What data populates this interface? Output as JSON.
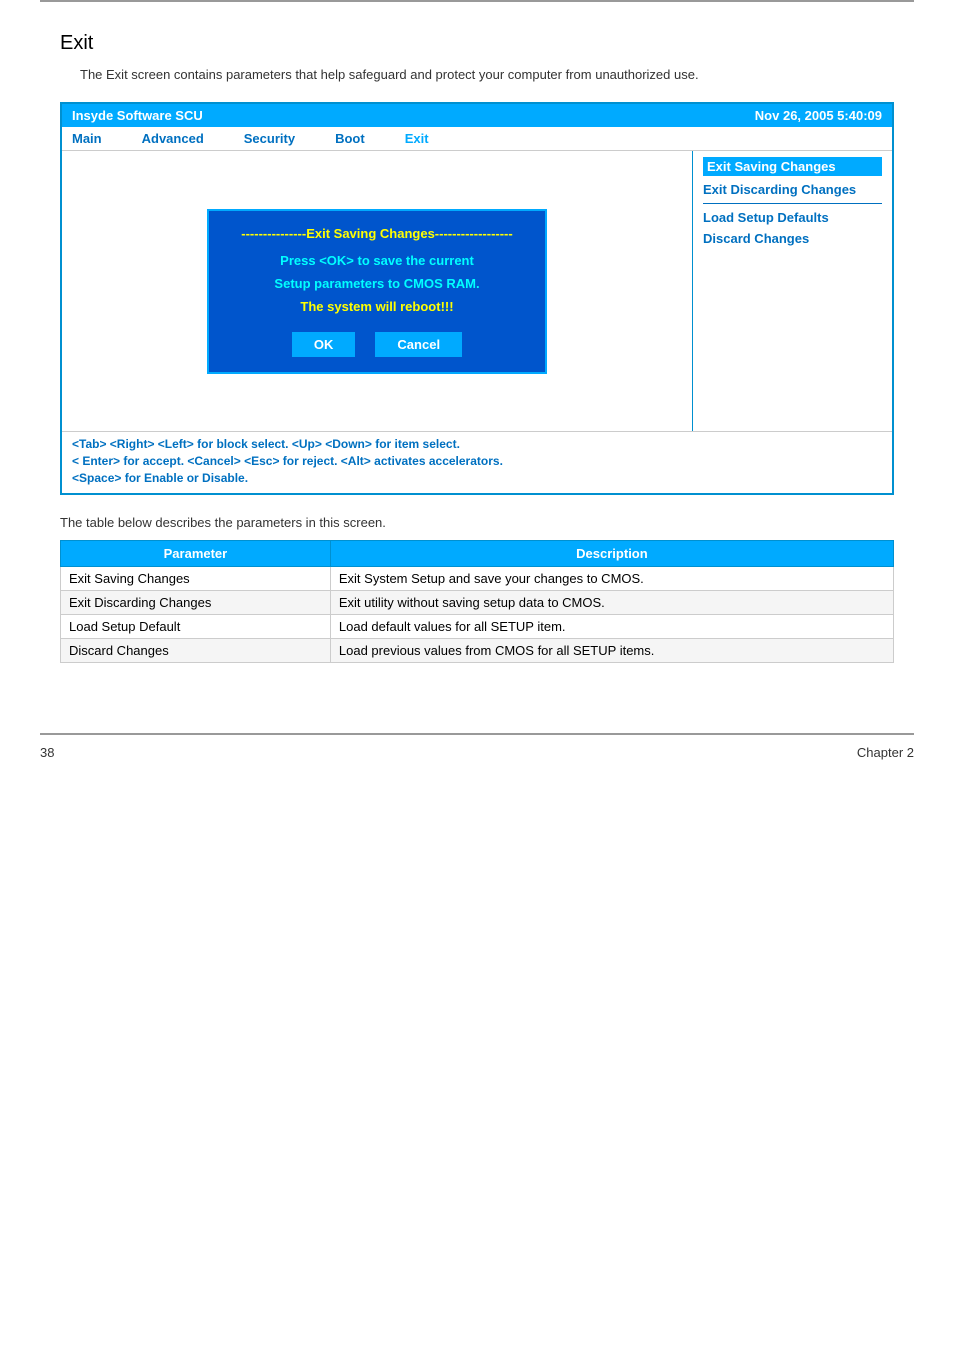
{
  "page": {
    "title": "Exit",
    "intro": "The Exit screen contains parameters that help safeguard and protect your computer from unauthorized use."
  },
  "bios": {
    "header": {
      "left": "Insyde Software SCU",
      "right": "Nov 26, 2005 5:40:09"
    },
    "nav": [
      {
        "label": "Main",
        "active": false
      },
      {
        "label": "Advanced",
        "active": false
      },
      {
        "label": "Security",
        "active": false
      },
      {
        "label": "Boot",
        "active": false
      },
      {
        "label": "Exit",
        "active": true
      }
    ],
    "right_panel": [
      {
        "label": "Exit Saving Changes",
        "highlight": true
      },
      {
        "label": "Exit Discarding Changes",
        "highlight": false
      },
      {
        "label": "Load Setup Defaults",
        "highlight": false
      },
      {
        "label": "Discard Changes",
        "highlight": false
      }
    ],
    "dialog": {
      "title": "---------------Exit Saving Changes------------------",
      "line1": "Press  <OK>  to  save  the current",
      "line2": "Setup parameters to CMOS RAM.",
      "line3": "The system will reboot!!!",
      "ok_btn": "OK",
      "cancel_btn": "Cancel"
    },
    "footer": [
      "<Tab> <Right> <Left> for block select.   <Up> <Down> for item select.",
      "< Enter> for accept. <Cancel> <Esc> for reject. <Alt> activates accelerators.",
      "<Space> for Enable or Disable."
    ]
  },
  "table": {
    "intro": "The table below describes the parameters in this screen.",
    "headers": [
      "Parameter",
      "Description"
    ],
    "rows": [
      {
        "param": "Exit Saving Changes",
        "desc": "Exit System Setup and save your changes to CMOS."
      },
      {
        "param": "Exit Discarding Changes",
        "desc": "Exit utility without saving setup data to CMOS."
      },
      {
        "param": "Load Setup Default",
        "desc": "Load default values for all SETUP item."
      },
      {
        "param": "Discard Changes",
        "desc": "Load previous values from CMOS for all SETUP items."
      }
    ]
  },
  "footer": {
    "page_num": "38",
    "chapter": "Chapter 2"
  }
}
